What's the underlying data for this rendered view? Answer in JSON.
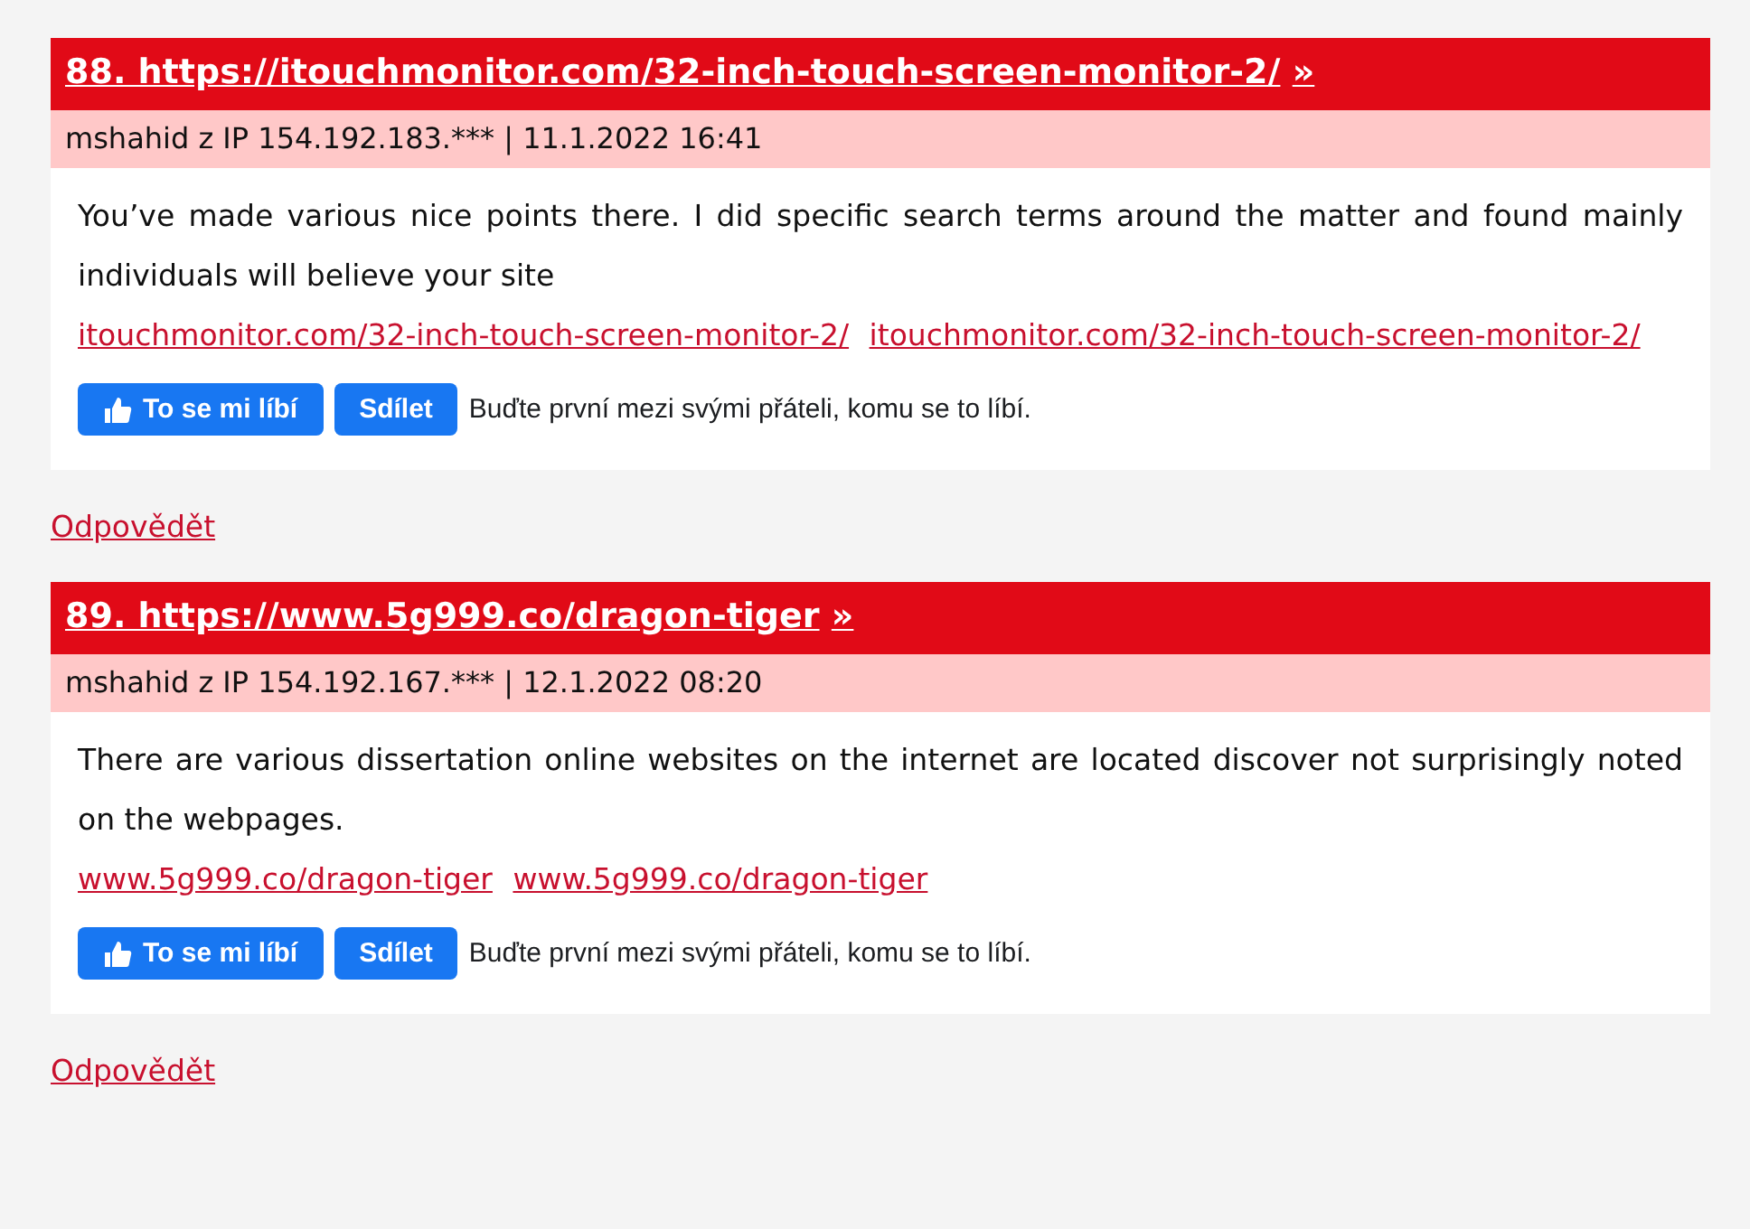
{
  "comments": [
    {
      "title_link": "88. https://itouchmonitor.com/32-inch-touch-screen-monitor-2/",
      "arrow_link": "»",
      "meta": "mshahid z IP 154.192.183.*** | 11.1.2022 16:41",
      "text": "You’ve made various nice points there. I did specific search terms around the matter and found mainly individuals will believe your site",
      "links": [
        "itouchmonitor.com/32-inch-touch-screen-monitor-2/",
        "itouchmonitor.com/32-inch-touch-screen-monitor-2/"
      ],
      "like_button": "To se mi líbí",
      "share_button": "Sdílet",
      "social_text": "Buďte první mezi svými přáteli, komu se to líbí.",
      "reply_link": "Odpovědět"
    },
    {
      "title_link": "89. https://www.5g999.co/dragon-tiger",
      "arrow_link": "»",
      "meta": "mshahid z IP 154.192.167.*** | 12.1.2022 08:20",
      "text": "There are various dissertation online websites on the internet are located discover not surprisingly noted on the webpages.",
      "links": [
        "www.5g999.co/dragon-tiger",
        "www.5g999.co/dragon-tiger"
      ],
      "like_button": "To se mi líbí",
      "share_button": "Sdílet",
      "social_text": "Buďte první mezi svými přáteli, komu se to líbí.",
      "reply_link": "Odpovědět"
    }
  ]
}
